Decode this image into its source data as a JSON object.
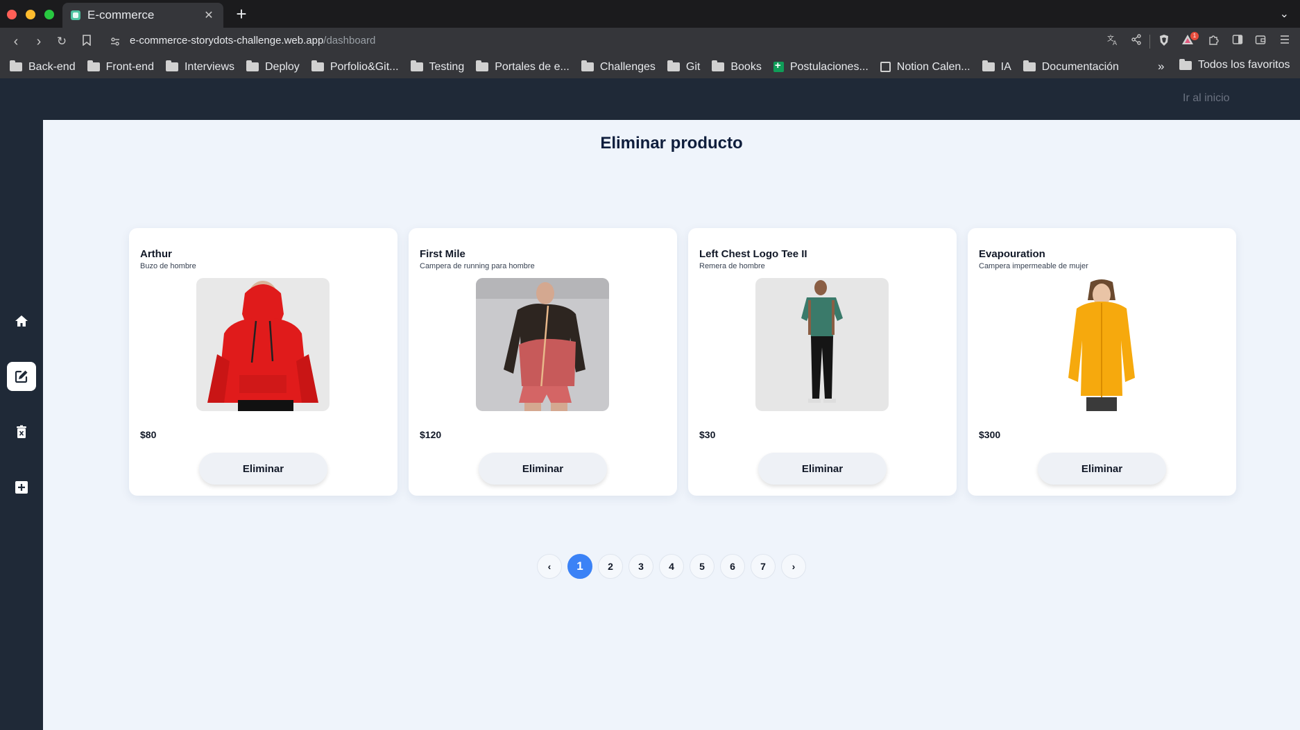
{
  "browser": {
    "tab_title": "E-commerce",
    "url_domain": "e-commerce-storydots-challenge.web.app",
    "url_path": "/dashboard",
    "bookmarks": [
      "Back-end",
      "Front-end",
      "Interviews",
      "Deploy",
      "Porfolio&Git...",
      "Testing",
      "Portales de e...",
      "Challenges",
      "Git",
      "Books",
      "Postulaciones...",
      "Notion Calen...",
      "IA",
      "Documentación"
    ],
    "bookmarks_more": "»",
    "all_bookmarks": "Todos los favoritos",
    "extension_badge": "1"
  },
  "header": {
    "home_link": "Ir al inicio"
  },
  "sidebar": {
    "items": [
      {
        "icon": "home-icon",
        "active": false
      },
      {
        "icon": "edit-icon",
        "active": true
      },
      {
        "icon": "delete-icon",
        "active": false
      },
      {
        "icon": "add-icon",
        "active": false
      }
    ]
  },
  "page": {
    "title": "Eliminar producto"
  },
  "products": [
    {
      "name": "Arthur",
      "description": "Buzo de hombre",
      "price": "$80",
      "button": "Eliminar",
      "image": "red-hoodie"
    },
    {
      "name": "First Mile",
      "description": "Campera de running para hombre",
      "price": "$120",
      "button": "Eliminar",
      "image": "running-jacket"
    },
    {
      "name": "Left Chest Logo Tee II",
      "description": "Remera de hombre",
      "price": "$30",
      "button": "Eliminar",
      "image": "green-tee"
    },
    {
      "name": "Evapouration",
      "description": "Campera impermeable de mujer",
      "price": "$300",
      "button": "Eliminar",
      "image": "yellow-rain-jacket"
    }
  ],
  "pagination": {
    "prev": "‹",
    "pages": [
      "1",
      "2",
      "3",
      "4",
      "5",
      "6",
      "7"
    ],
    "current": "1",
    "next": "›"
  },
  "colors": {
    "accent": "#3b82f6",
    "sidebar_bg": "#1f2937",
    "content_bg": "#eff4fb",
    "title": "#0f1e3c"
  }
}
